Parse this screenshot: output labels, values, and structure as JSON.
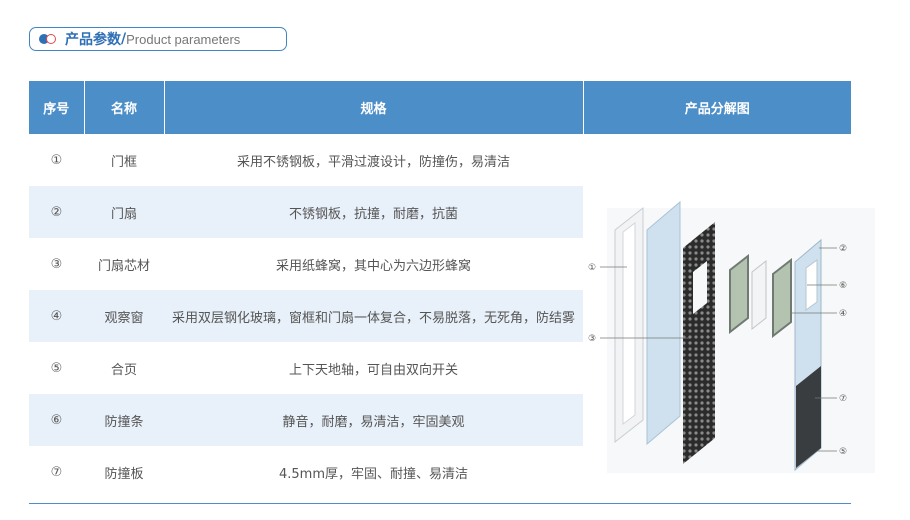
{
  "header": {
    "title_cn": "产品参数",
    "separator": "/",
    "title_en": "Product parameters"
  },
  "table": {
    "columns": [
      "序号",
      "名称",
      "规格",
      "产品分解图"
    ],
    "rows": [
      {
        "no": "①",
        "name": "门框",
        "spec": "采用不锈钢板，平滑过渡设计，防撞伤，易清洁"
      },
      {
        "no": "②",
        "name": "门扇",
        "spec": "不锈钢板，抗撞，耐磨，抗菌"
      },
      {
        "no": "③",
        "name": "门扇芯材",
        "spec": "采用纸蜂窝，其中心为六边形蜂窝"
      },
      {
        "no": "④",
        "name": "观察窗",
        "spec": "采用双层钢化玻璃，窗框和门扇一体复合，不易脱落，无死角，防结雾"
      },
      {
        "no": "⑤",
        "name": "合页",
        "spec": "上下天地轴，可自由双向开关"
      },
      {
        "no": "⑥",
        "name": "防撞条",
        "spec": "静音，耐磨，易清洁，牢固美观"
      },
      {
        "no": "⑦",
        "name": "防撞板",
        "spec": "4.5mm厚，牢固、耐撞、易清洁"
      }
    ]
  },
  "diagram": {
    "labels": {
      "l1": "①",
      "l3": "③",
      "r2": "②",
      "r6": "⑥",
      "r4": "④",
      "r7": "⑦",
      "r5": "⑤"
    }
  },
  "colors": {
    "accent": "#4c8ec8",
    "title": "#2f6fb5",
    "row_alt": "#e8f0f9"
  }
}
